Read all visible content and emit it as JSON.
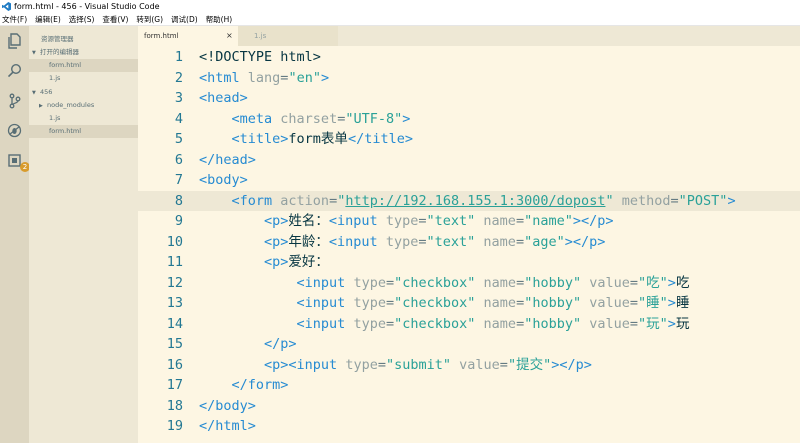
{
  "window": {
    "title": "form.html - 456 - Visual Studio Code"
  },
  "menu": [
    "文件(F)",
    "编辑(E)",
    "选择(S)",
    "查看(V)",
    "转到(G)",
    "调试(D)",
    "帮助(H)"
  ],
  "activity": {
    "badge": "2"
  },
  "sidebar": {
    "title": "资源管理器",
    "open_editors_label": "打开的编辑器",
    "open_editors": [
      "form.html",
      "1.js"
    ],
    "folder_label": "456",
    "folder_items": [
      "node_modules",
      "1.js",
      "form.html"
    ]
  },
  "tabs": [
    {
      "label": "form.html",
      "close": "×"
    },
    {
      "label": "1.js"
    }
  ],
  "editor": {
    "lines": [
      {
        "n": "1",
        "tokens": [
          [
            "k-doc",
            "<!DOCTYPE html>"
          ]
        ]
      },
      {
        "n": "2",
        "tokens": [
          [
            "k-tag",
            "<html"
          ],
          [
            "",
            " "
          ],
          [
            "k-attr",
            "lang"
          ],
          [
            "",
            "="
          ],
          [
            "k-str",
            "\"en\""
          ],
          [
            "k-tag",
            ">"
          ]
        ]
      },
      {
        "n": "3",
        "tokens": [
          [
            "k-tag",
            "<head>"
          ]
        ]
      },
      {
        "n": "4",
        "tokens": [
          [
            "",
            "    "
          ],
          [
            "k-tag",
            "<meta"
          ],
          [
            "",
            " "
          ],
          [
            "k-attr",
            "charset"
          ],
          [
            "",
            "="
          ],
          [
            "k-str",
            "\"UTF-8\""
          ],
          [
            "k-tag",
            ">"
          ]
        ]
      },
      {
        "n": "5",
        "tokens": [
          [
            "",
            "    "
          ],
          [
            "k-tag",
            "<title>"
          ],
          [
            "k-txt",
            "form表单"
          ],
          [
            "k-tag",
            "</title>"
          ]
        ]
      },
      {
        "n": "6",
        "tokens": [
          [
            "k-tag",
            "</head>"
          ]
        ]
      },
      {
        "n": "7",
        "tokens": [
          [
            "k-tag",
            "<body>"
          ]
        ]
      },
      {
        "n": "8",
        "tokens": [
          [
            "",
            "    "
          ],
          [
            "k-tag",
            "<form"
          ],
          [
            "",
            " "
          ],
          [
            "k-attr",
            "action"
          ],
          [
            "",
            "="
          ],
          [
            "k-str",
            "\""
          ],
          [
            "k-url",
            "http://192.168.155.1:3000/dopost"
          ],
          [
            "k-str",
            "\""
          ],
          [
            "",
            " "
          ],
          [
            "k-attr",
            "method"
          ],
          [
            "",
            "="
          ],
          [
            "k-str",
            "\"POST\""
          ],
          [
            "k-tag",
            ">"
          ]
        ]
      },
      {
        "n": "9",
        "tokens": [
          [
            "",
            "        "
          ],
          [
            "k-tag",
            "<p>"
          ],
          [
            "k-txt",
            "姓名："
          ],
          [
            "k-tag",
            "<input"
          ],
          [
            "",
            " "
          ],
          [
            "k-attr",
            "type"
          ],
          [
            "",
            "="
          ],
          [
            "k-str",
            "\"text\""
          ],
          [
            "",
            " "
          ],
          [
            "k-attr",
            "name"
          ],
          [
            "",
            "="
          ],
          [
            "k-str",
            "\"name\""
          ],
          [
            "k-tag",
            "></p>"
          ]
        ]
      },
      {
        "n": "10",
        "tokens": [
          [
            "",
            "        "
          ],
          [
            "k-tag",
            "<p>"
          ],
          [
            "k-txt",
            "年龄："
          ],
          [
            "k-tag",
            "<input"
          ],
          [
            "",
            " "
          ],
          [
            "k-attr",
            "type"
          ],
          [
            "",
            "="
          ],
          [
            "k-str",
            "\"text\""
          ],
          [
            "",
            " "
          ],
          [
            "k-attr",
            "name"
          ],
          [
            "",
            "="
          ],
          [
            "k-str",
            "\"age\""
          ],
          [
            "k-tag",
            "></p>"
          ]
        ]
      },
      {
        "n": "11",
        "tokens": [
          [
            "",
            "        "
          ],
          [
            "k-tag",
            "<p>"
          ],
          [
            "k-txt",
            "爱好："
          ]
        ]
      },
      {
        "n": "12",
        "tokens": [
          [
            "",
            "            "
          ],
          [
            "k-tag",
            "<input"
          ],
          [
            "",
            " "
          ],
          [
            "k-attr",
            "type"
          ],
          [
            "",
            "="
          ],
          [
            "k-str",
            "\"checkbox\""
          ],
          [
            "",
            " "
          ],
          [
            "k-attr",
            "name"
          ],
          [
            "",
            "="
          ],
          [
            "k-str",
            "\"hobby\""
          ],
          [
            "",
            " "
          ],
          [
            "k-attr",
            "value"
          ],
          [
            "",
            "="
          ],
          [
            "k-str",
            "\"吃\""
          ],
          [
            "k-tag",
            ">"
          ],
          [
            "k-txt",
            "吃"
          ]
        ]
      },
      {
        "n": "13",
        "tokens": [
          [
            "",
            "            "
          ],
          [
            "k-tag",
            "<input"
          ],
          [
            "",
            " "
          ],
          [
            "k-attr",
            "type"
          ],
          [
            "",
            "="
          ],
          [
            "k-str",
            "\"checkbox\""
          ],
          [
            "",
            " "
          ],
          [
            "k-attr",
            "name"
          ],
          [
            "",
            "="
          ],
          [
            "k-str",
            "\"hobby\""
          ],
          [
            "",
            " "
          ],
          [
            "k-attr",
            "value"
          ],
          [
            "",
            "="
          ],
          [
            "k-str",
            "\"睡\""
          ],
          [
            "k-tag",
            ">"
          ],
          [
            "k-txt",
            "睡"
          ]
        ]
      },
      {
        "n": "14",
        "tokens": [
          [
            "",
            "            "
          ],
          [
            "k-tag",
            "<input"
          ],
          [
            "",
            " "
          ],
          [
            "k-attr",
            "type"
          ],
          [
            "",
            "="
          ],
          [
            "k-str",
            "\"checkbox\""
          ],
          [
            "",
            " "
          ],
          [
            "k-attr",
            "name"
          ],
          [
            "",
            "="
          ],
          [
            "k-str",
            "\"hobby\""
          ],
          [
            "",
            " "
          ],
          [
            "k-attr",
            "value"
          ],
          [
            "",
            "="
          ],
          [
            "k-str",
            "\"玩\""
          ],
          [
            "k-tag",
            ">"
          ],
          [
            "k-txt",
            "玩"
          ]
        ]
      },
      {
        "n": "15",
        "tokens": [
          [
            "",
            "        "
          ],
          [
            "k-tag",
            "</p>"
          ]
        ]
      },
      {
        "n": "16",
        "tokens": [
          [
            "",
            "        "
          ],
          [
            "k-tag",
            "<p><input"
          ],
          [
            "",
            " "
          ],
          [
            "k-attr",
            "type"
          ],
          [
            "",
            "="
          ],
          [
            "k-str",
            "\"submit\""
          ],
          [
            "",
            " "
          ],
          [
            "k-attr",
            "value"
          ],
          [
            "",
            "="
          ],
          [
            "k-str",
            "\"提交\""
          ],
          [
            "k-tag",
            "></p>"
          ]
        ]
      },
      {
        "n": "17",
        "tokens": [
          [
            "",
            "    "
          ],
          [
            "k-tag",
            "</form>"
          ]
        ]
      },
      {
        "n": "18",
        "tokens": [
          [
            "k-tag",
            "</body>"
          ]
        ]
      },
      {
        "n": "19",
        "tokens": [
          [
            "k-tag",
            "</html>"
          ]
        ]
      }
    ],
    "highlight_line": "8"
  },
  "colors": {
    "editor_bg": "#fdf6e3",
    "sidebar_bg": "#eee8d5",
    "activity_bg": "#ddd6c1",
    "tag": "#268bd2",
    "string": "#2aa198",
    "line_number": "#237893"
  }
}
